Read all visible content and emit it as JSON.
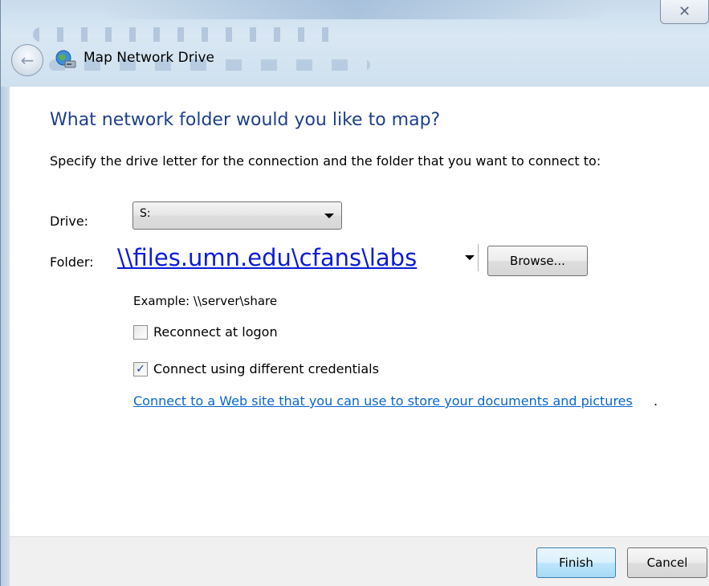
{
  "window": {
    "title": "Map Network Drive",
    "close_glyph": "✕",
    "back_glyph": "←"
  },
  "page": {
    "heading": "What network folder would you like to map?",
    "instruction": "Specify the drive letter for the connection and the folder that you want to connect to:"
  },
  "drive": {
    "label": "Drive:",
    "value": "S:"
  },
  "folder": {
    "label": "Folder:",
    "value": "\\\\files.umn.edu\\cfans\\labs",
    "browse_label": "Browse...",
    "example": "Example: \\\\server\\share"
  },
  "options": {
    "reconnect_label": "Reconnect at logon",
    "reconnect_checked": false,
    "credentials_label": "Connect using different credentials",
    "credentials_checked": true
  },
  "web_link": {
    "text": "Connect to a Web site that you can use to store your documents and pictures",
    "trailing": "."
  },
  "footer": {
    "finish_label": "Finish",
    "cancel_label": "Cancel"
  },
  "colors": {
    "heading": "#1e3f8c",
    "link": "#0a66cc",
    "folder_text": "#0b1bd8"
  }
}
